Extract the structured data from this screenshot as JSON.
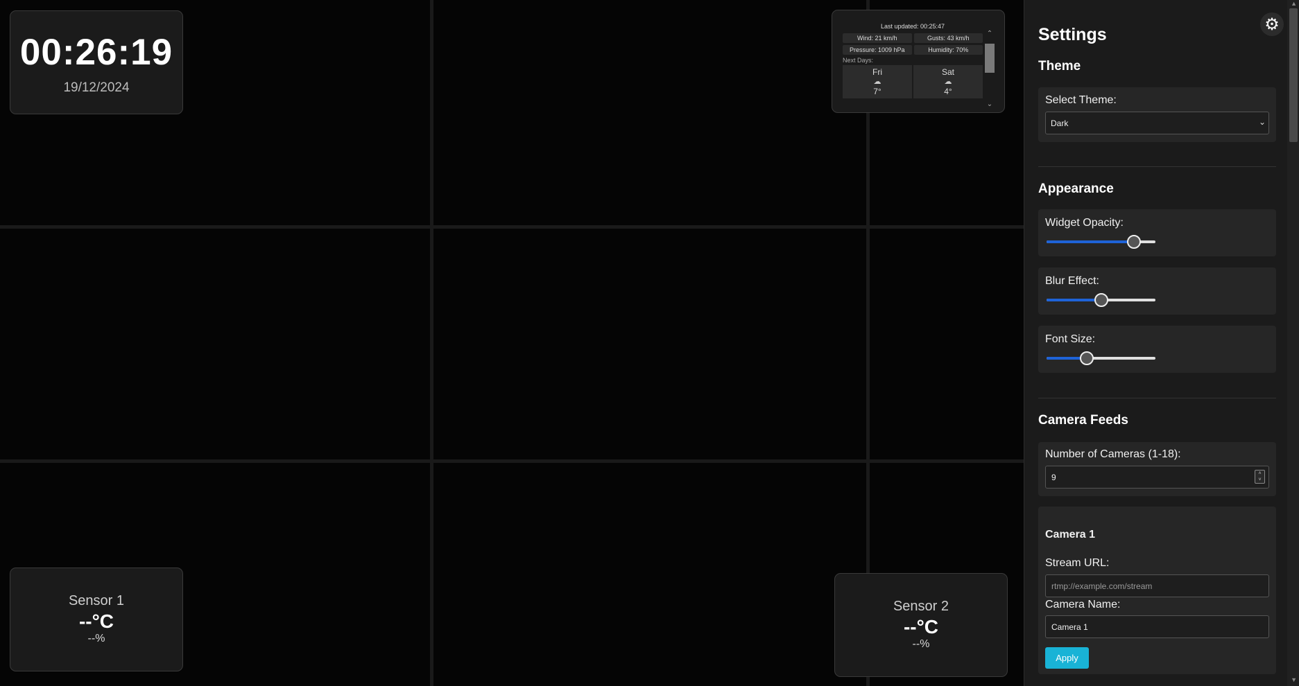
{
  "clock": {
    "time": "00:26:19",
    "date": "19/12/2024"
  },
  "weather": {
    "updated": "Last updated: 00:25:47",
    "wind": "Wind: 21 km/h",
    "gusts": "Gusts: 43 km/h",
    "pressure": "Pressure: 1009 hPa",
    "humidity": "Humidity: 70%",
    "next_days_label": "Next Days:",
    "days": [
      {
        "name": "Fri",
        "icon": "cloud-icon",
        "glyph": "☁",
        "temp": "7°"
      },
      {
        "name": "Sat",
        "icon": "cloud-icon",
        "glyph": "☁",
        "temp": "4°"
      }
    ]
  },
  "sensors": [
    {
      "name": "Sensor 1",
      "temp": "--°C",
      "humidity": "--%"
    },
    {
      "name": "Sensor 2",
      "temp": "--°C",
      "humidity": "--%"
    }
  ],
  "settings": {
    "title": "Settings",
    "gear_glyph": "⚙",
    "theme": {
      "heading": "Theme",
      "select_label": "Select Theme:",
      "selected": "Dark",
      "chevron": "⌄"
    },
    "appearance": {
      "heading": "Appearance",
      "opacity_label": "Widget Opacity:",
      "opacity_value": 0.85,
      "blur_label": "Blur Effect:",
      "blur_value": 0.5,
      "font_label": "Font Size:",
      "font_value": 0.35
    },
    "cameras": {
      "heading": "Camera Feeds",
      "count_label": "Number of Cameras (1-18):",
      "count_value": "9",
      "camera1": {
        "title": "Camera 1",
        "url_label": "Stream URL:",
        "url_placeholder": "rtmp://example.com/stream",
        "name_label": "Camera Name:",
        "name_value": "Camera 1",
        "apply_label": "Apply"
      }
    }
  },
  "colors": {
    "accent": "#1e63d8",
    "apply": "#19b3d6",
    "panel": "#1b1b1b"
  }
}
